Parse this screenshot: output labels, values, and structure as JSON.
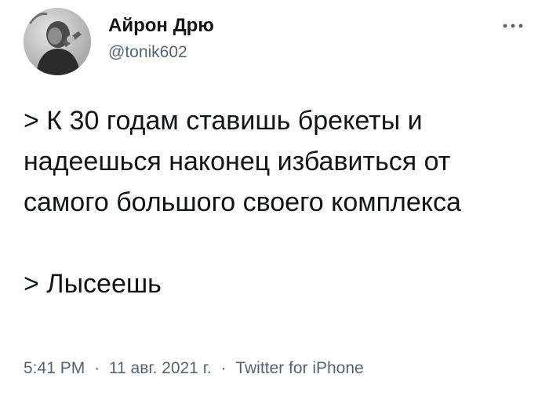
{
  "author": {
    "display_name": "Айрон Дрю",
    "handle": "@tonik602"
  },
  "tweet": {
    "paragraphs": [
      "> К 30 годам ставишь брекеты и надеешься наконец избавиться от самого большого своего комплекса",
      "> Лысеешь"
    ]
  },
  "meta": {
    "time": "5:41 PM",
    "date": "11 авг. 2021 г.",
    "separator": "·",
    "source": "Twitter for iPhone"
  },
  "icons": {
    "more": "more-horizontal-icon",
    "avatar": "user-avatar"
  },
  "colors": {
    "text": "#0f1419",
    "secondary": "#536471",
    "background": "#ffffff"
  }
}
